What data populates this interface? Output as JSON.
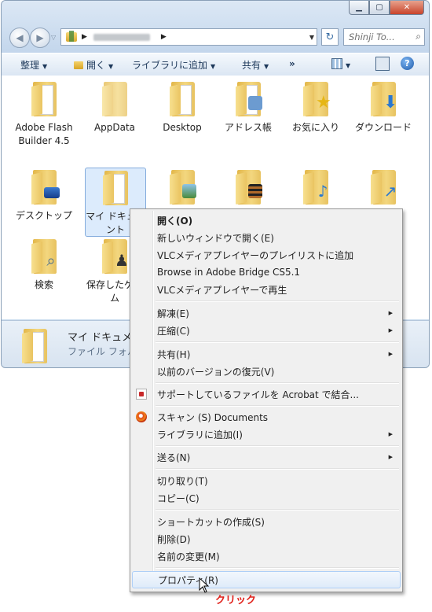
{
  "window": {
    "search_placeholder": "Shinji To...",
    "toolbar": {
      "organize": "整理",
      "open": "開く",
      "add_to_library": "ライブラリに追加",
      "share": "共有",
      "more": "»"
    }
  },
  "items": [
    {
      "label": "Adobe Flash Builder 4.5",
      "icon": "folder-icon"
    },
    {
      "label": "AppData",
      "icon": "folder-icon"
    },
    {
      "label": "Desktop",
      "icon": "folder-icon"
    },
    {
      "label": "アドレス帳",
      "icon": "contacts-folder-icon"
    },
    {
      "label": "お気に入り",
      "icon": "favorites-folder-icon"
    },
    {
      "label": "ダウンロード",
      "icon": "downloads-folder-icon"
    },
    {
      "label": "デスクトップ",
      "icon": "desktop-folder-icon"
    },
    {
      "label": "マイ ドキュメント",
      "icon": "documents-folder-icon"
    },
    {
      "label": "",
      "icon": "pictures-folder-icon"
    },
    {
      "label": "",
      "icon": "videos-folder-icon"
    },
    {
      "label": "",
      "icon": "music-folder-icon"
    },
    {
      "label": "",
      "icon": "links-folder-icon"
    },
    {
      "label": "検索",
      "icon": "searches-folder-icon"
    },
    {
      "label": "保存したゲーム",
      "icon": "saved-games-folder-icon"
    }
  ],
  "details": {
    "name": "マイ ドキュメ",
    "type": "ファイル フォル"
  },
  "context_menu": {
    "items": [
      {
        "label": "開く(O)"
      },
      {
        "label": "新しいウィンドウで開く(E)"
      },
      {
        "label": "VLCメディアプレイヤーのプレイリストに追加"
      },
      {
        "label": "Browse in Adobe Bridge CS5.1"
      },
      {
        "label": "VLCメディアプレイヤーで再生"
      },
      {
        "label": "解凍(E)"
      },
      {
        "label": "圧縮(C)"
      },
      {
        "label": "共有(H)"
      },
      {
        "label": "以前のバージョンの復元(V)"
      },
      {
        "label": "サポートしているファイルを Acrobat で結合..."
      },
      {
        "label": "スキャン (S) Documents"
      },
      {
        "label": "ライブラリに追加(I)"
      },
      {
        "label": "送る(N)"
      },
      {
        "label": "切り取り(T)"
      },
      {
        "label": "コピー(C)"
      },
      {
        "label": "ショートカットの作成(S)"
      },
      {
        "label": "削除(D)"
      },
      {
        "label": "名前の変更(M)"
      },
      {
        "label": "プロパティ(R)"
      }
    ]
  },
  "annotation": {
    "click_label": "クリック",
    "color": "#e0201a"
  }
}
